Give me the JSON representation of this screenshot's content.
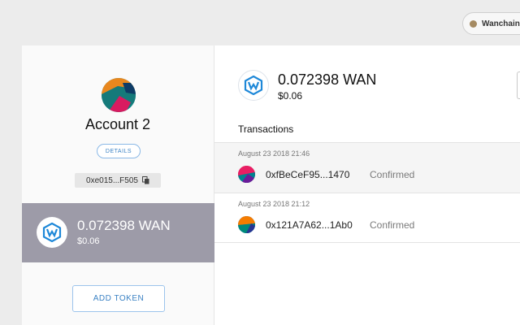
{
  "network": {
    "label": "Wanchain N",
    "dot_color": "#a58a62"
  },
  "account": {
    "name": "Account 2",
    "details_label": "DETAILS",
    "address_short": "0xe015...F505",
    "copy_icon": "copy-icon"
  },
  "sidebar_token": {
    "amount": "0.072398 WAN",
    "usd": "$0.06",
    "icon": "wanchain-logo-icon",
    "highlight_color": "#9d9ba8"
  },
  "add_token_label": "ADD TOKEN",
  "balance": {
    "amount": "0.072398 WAN",
    "usd": "$0.06"
  },
  "transactions": {
    "heading": "Transactions",
    "items": [
      {
        "date": "August 23 2018 21:46",
        "address": "0xfBeCeF95...1470",
        "status": "Confirmed",
        "icon": "identicon-icon"
      },
      {
        "date": "August 23 2018 21:12",
        "address": "0x121A7A62...1Ab0",
        "status": "Confirmed",
        "icon": "identicon-icon"
      }
    ]
  },
  "colors": {
    "accent": "#3b82c4",
    "wan_blue": "#1e88d8"
  }
}
